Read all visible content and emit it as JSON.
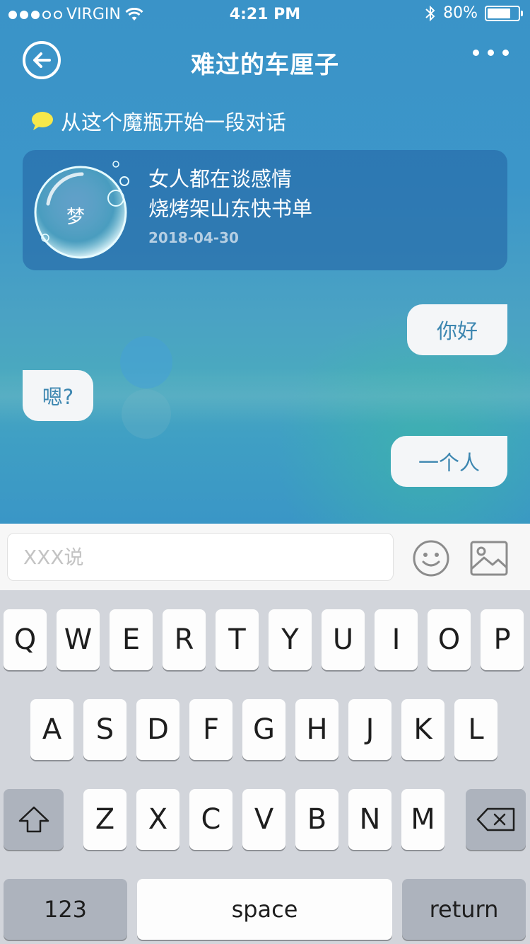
{
  "status_bar": {
    "carrier": "VIRGIN",
    "time": "4:21 PM",
    "battery": "80%",
    "battery_level": 0.8,
    "signal_bars": 3,
    "signal_total": 5
  },
  "nav": {
    "title": "难过的车厘子",
    "back_icon": "back-arrow-circle-icon",
    "more_icon": "more-dots-icon"
  },
  "prompt": {
    "text": "从这个魔瓶开始一段对话",
    "icon": "speech-bubble-icon",
    "icon_color": "#f7e84a"
  },
  "bottle_card": {
    "bubble_char": "梦",
    "line1": "女人都在谈感情",
    "line2": "烧烤架山东快书单",
    "date": "2018-04-30"
  },
  "messages": [
    {
      "side": "right",
      "text": "你好"
    },
    {
      "side": "left",
      "text": "嗯?"
    },
    {
      "side": "right",
      "text": "一个人"
    }
  ],
  "input_bar": {
    "placeholder": "XXX说",
    "emoji_icon": "smiley-face-icon",
    "image_icon": "image-picture-icon"
  },
  "keyboard": {
    "row1": [
      "Q",
      "W",
      "E",
      "R",
      "T",
      "Y",
      "U",
      "I",
      "O",
      "P"
    ],
    "row2": [
      "A",
      "S",
      "D",
      "F",
      "G",
      "H",
      "J",
      "K",
      "L"
    ],
    "row3": [
      "Z",
      "X",
      "C",
      "V",
      "B",
      "N",
      "M"
    ],
    "shift_icon": "shift-arrow-icon",
    "delete_icon": "backspace-icon",
    "numbers_label": "123",
    "space_label": "space",
    "return_label": "return"
  },
  "colors": {
    "chat_bg": "#3a96c6",
    "card_bg": "#2d72ab",
    "message_text": "#3c86b0",
    "keyboard_bg": "#d2d5db"
  }
}
